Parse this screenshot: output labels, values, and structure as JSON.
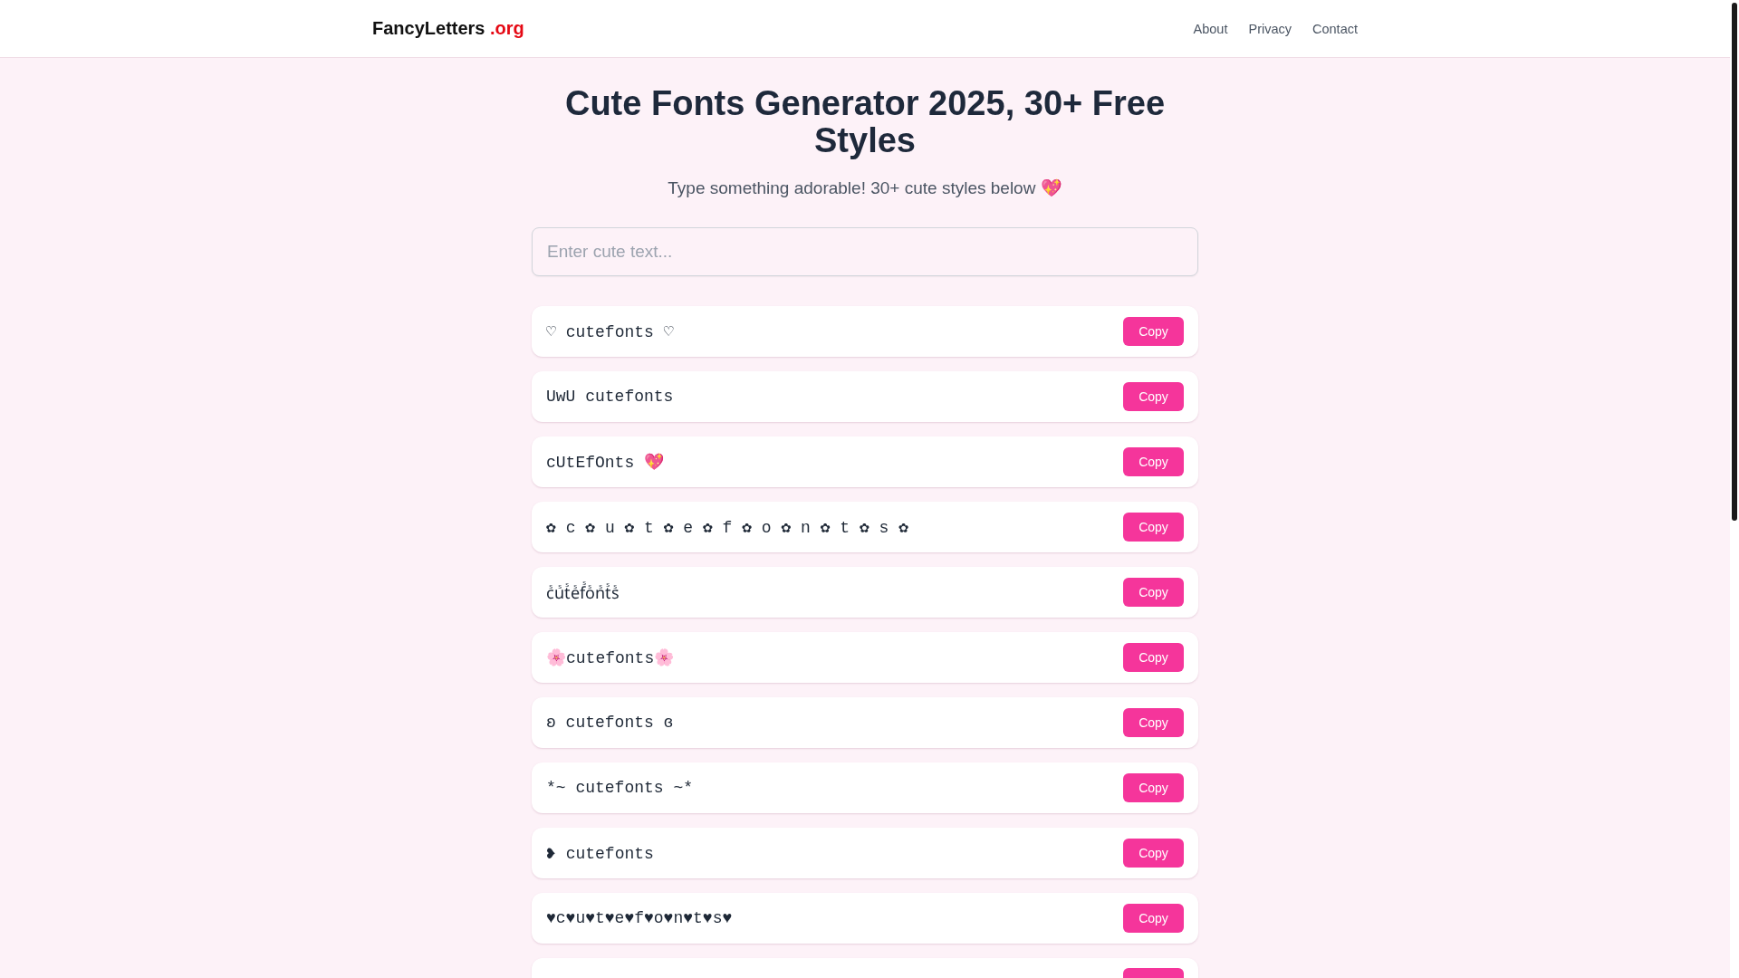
{
  "header": {
    "logo": {
      "name": "FancyLetters",
      "suffix": ".org"
    },
    "nav": [
      "About",
      "Privacy",
      "Contact"
    ]
  },
  "hero": {
    "title": "Cute Fonts Generator 2025, 30+ Free Styles",
    "subtitle": "Type something adorable! 30+ cute styles below 💖"
  },
  "input": {
    "placeholder": "Enter cute text..."
  },
  "results": [
    {
      "kind": "full",
      "text": "♡ cutefonts ♡",
      "button": "Copy"
    },
    {
      "kind": "full",
      "text": "UwU cutefonts",
      "button": "Copy"
    },
    {
      "kind": "full",
      "text": "cUtEfOnts 💖",
      "button": "Copy"
    },
    {
      "kind": "full",
      "text": "✿ c ✿ u ✿ t ✿ e ✿ f ✿ o ✿ n ✿ t ✿ s ✿",
      "button": "Copy"
    },
    {
      "kind": "full",
      "text": "cᷤuᷤtᷤeᷤfᷤoᷤnᷤtᷤsᷤ",
      "button": "Copy"
    },
    {
      "kind": "full",
      "text": "🌸cutefonts🌸",
      "button": "Copy"
    },
    {
      "kind": "full",
      "text": "ʚ cutefonts ɞ",
      "button": "Copy"
    },
    {
      "kind": "full",
      "text": "*~ cutefonts ~*",
      "button": "Copy"
    },
    {
      "kind": "full",
      "text": "❥ cutefonts",
      "button": "Copy"
    },
    {
      "kind": "full",
      "text": "♥c♥u♥t♥e♥f♥o♥n♥t♥s♥",
      "button": "Copy"
    },
    {
      "kind": "partial"
    }
  ]
}
